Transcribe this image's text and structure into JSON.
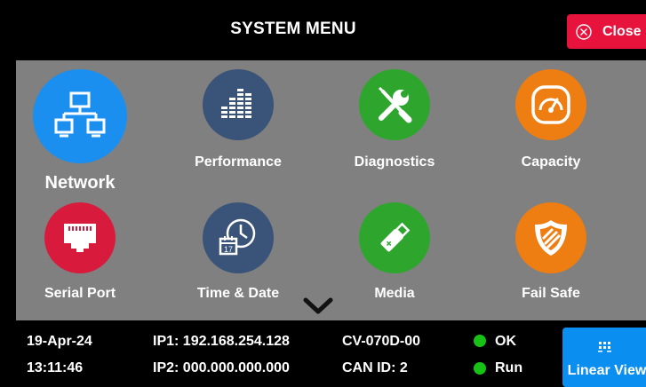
{
  "header": {
    "title": "SYSTEM MENU",
    "close_label": "Close"
  },
  "menu": {
    "items": [
      {
        "label": "Network",
        "icon": "network-icon",
        "color": "#1a8ff0"
      },
      {
        "label": "Performance",
        "icon": "performance-bars-icon",
        "color": "#3a5378"
      },
      {
        "label": "Diagnostics",
        "icon": "wrench-screwdriver-icon",
        "color": "#2ea62e"
      },
      {
        "label": "Capacity",
        "icon": "gauge-icon",
        "color": "#ee7d12"
      },
      {
        "label": "Serial Port",
        "icon": "ethernet-port-icon",
        "color": "#d81a3c"
      },
      {
        "label": "Time & Date",
        "icon": "clock-calendar-icon",
        "color": "#3a5378"
      },
      {
        "label": "Media",
        "icon": "usb-drive-icon",
        "color": "#2ea62e"
      },
      {
        "label": "Fail Safe",
        "icon": "shield-icon",
        "color": "#ee7d12"
      }
    ],
    "calendar_day": "17",
    "more_icon": "chevron-down-icon"
  },
  "status": {
    "date": "19-Apr-24",
    "time": "13:11:46",
    "ip1": "IP1: 192.168.254.128",
    "ip2": "IP2: 000.000.000.000",
    "model": "CV-070D-00",
    "can_id": "CAN ID: 2",
    "ok_label": "OK",
    "run_label": "Run",
    "ok_color": "#15c215",
    "linear_view_label": "Linear View"
  }
}
